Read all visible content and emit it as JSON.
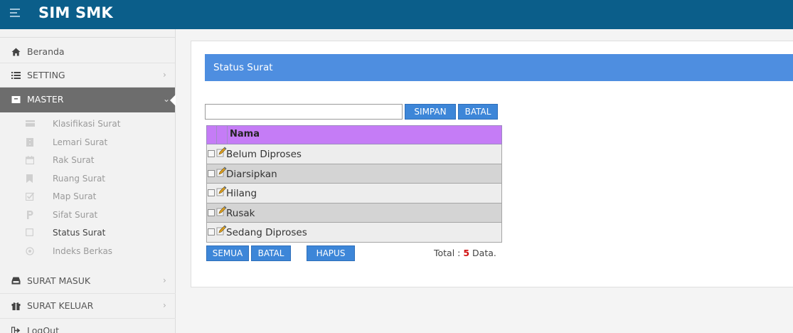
{
  "app": {
    "title": "SIM SMK",
    "icon": "hamburger-menu-icon"
  },
  "sidebar": {
    "items": [
      {
        "label": "Beranda",
        "icon": "home-icon"
      },
      {
        "label": "SETTING",
        "icon": "list-icon"
      },
      {
        "label": "MASTER",
        "icon": "folder-icon"
      }
    ],
    "master_submenu": [
      {
        "label": "Klasifikasi Surat",
        "icon": "card-icon"
      },
      {
        "label": "Lemari Surat",
        "icon": "cabinet-icon"
      },
      {
        "label": "Rak Surat",
        "icon": "calendar-icon"
      },
      {
        "label": "Ruang Surat",
        "icon": "bookmark-icon"
      },
      {
        "label": "Map Surat",
        "icon": "checkbox-icon"
      },
      {
        "label": "Sifat Surat",
        "icon": "p-icon"
      },
      {
        "label": "Status Surat",
        "icon": "square-icon"
      },
      {
        "label": "Indeks Berkas",
        "icon": "target-icon"
      }
    ],
    "lower_items": [
      {
        "label": "SURAT MASUK",
        "icon": "inbox-icon"
      },
      {
        "label": "SURAT KELUAR",
        "icon": "gift-icon"
      },
      {
        "label": "LogOut",
        "icon": "logout-icon"
      }
    ]
  },
  "panel": {
    "title": "Status Surat"
  },
  "form": {
    "name_value": "",
    "save_label": "SIMPAN",
    "cancel_label": "BATAL"
  },
  "grid": {
    "header": "Nama",
    "rows": [
      "Belum Diproses",
      "Diarsipkan",
      "Hilang",
      "Rusak",
      "Sedang Diproses"
    ]
  },
  "footer": {
    "all_label": "SEMUA",
    "cancel_label": "BATAL",
    "delete_label": "HAPUS",
    "total_prefix": "Total : ",
    "total_count": "5",
    "total_suffix": " Data."
  },
  "colors": {
    "topbar": "#0b5e8a",
    "panel_header": "#4e8ee0",
    "grid_header": "#c57cf6",
    "button": "#3d86d8",
    "active_nav": "#6d6d6d",
    "total_count": "#d01010"
  }
}
